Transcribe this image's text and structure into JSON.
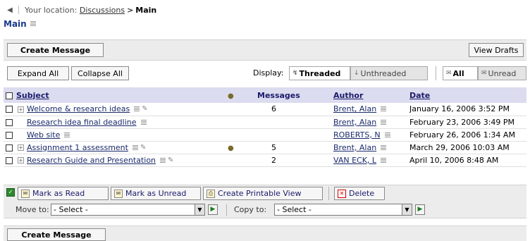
{
  "breadcrumb": {
    "prefix": "Your location:",
    "parent": "Discussions",
    "separator": ">",
    "current": "Main"
  },
  "page_title": "Main",
  "top_bar": {
    "create_message": "Create Message",
    "view_drafts": "View Drafts"
  },
  "toolbar": {
    "expand_all": "Expand All",
    "collapse_all": "Collapse All",
    "display_label": "Display:",
    "threaded": "Threaded",
    "unthreaded": "Unthreaded",
    "all": "All",
    "unread": "Unread"
  },
  "table": {
    "columns": {
      "subject": "Subject",
      "messages": "Messages",
      "author": "Author",
      "date": "Date"
    },
    "rows": [
      {
        "subject": "Welcome & research ideas",
        "expandable": true,
        "attachment": false,
        "messages": "6",
        "author": "Brent, Alan",
        "date": "January 16, 2006 3:52 PM"
      },
      {
        "subject": "Research idea final deadline",
        "expandable": false,
        "attachment": false,
        "messages": "",
        "author": "Brent, Alan",
        "date": "February 23, 2006 3:49 PM"
      },
      {
        "subject": "Web site",
        "expandable": false,
        "attachment": false,
        "messages": "",
        "author": "ROBERTS, N",
        "date": "February 26, 2006 1:34 AM"
      },
      {
        "subject": "Assignment 1 assessment",
        "expandable": true,
        "attachment": true,
        "messages": "5",
        "author": "Brent, Alan",
        "date": "March 29, 2006 10:03 AM"
      },
      {
        "subject": "Research Guide and Presentation",
        "expandable": true,
        "attachment": false,
        "messages": "2",
        "author": "VAN ECK, L",
        "date": "April 10, 2006 8:48 AM"
      }
    ]
  },
  "actions": {
    "mark_read": "Mark as Read",
    "mark_unread": "Mark as Unread",
    "printable": "Create Printable View",
    "delete": "Delete",
    "move_to_label": "Move to:",
    "move_to_value": "- Select -",
    "copy_to_label": "Copy to:",
    "copy_to_value": "- Select -"
  },
  "bottom_bar": {
    "create_message": "Create Message"
  }
}
